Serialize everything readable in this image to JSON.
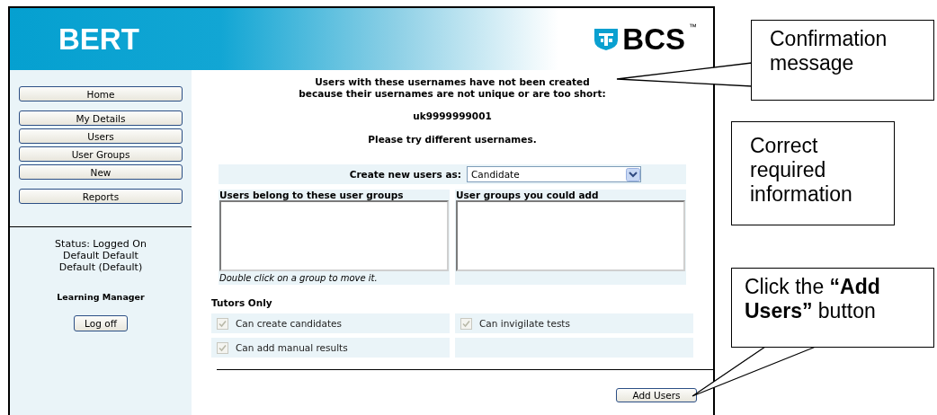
{
  "header": {
    "title": "BERT",
    "logo": {
      "text": "BCS",
      "mark": "™"
    }
  },
  "sidebar": {
    "nav_groups": [
      [
        {
          "label": "Home"
        }
      ],
      [
        {
          "label": "My Details"
        },
        {
          "label": "Users"
        },
        {
          "label": "User Groups"
        },
        {
          "label": "New"
        }
      ],
      [
        {
          "label": "Reports"
        }
      ]
    ],
    "status": [
      "Status: Logged On",
      "Default Default",
      "Default (Default)"
    ],
    "role": "Learning Manager",
    "logoff": "Log off"
  },
  "message": {
    "lines": [
      "Users with these usernames have not been created",
      "because their usernames are not unique or are too short:"
    ],
    "username": "uk9999999001",
    "hint": "Please try different usernames."
  },
  "form": {
    "create_as_label": "Create new users as:",
    "create_as_value": "Candidate",
    "groups": [
      {
        "heading": "Users belong to these user groups",
        "note": "Double click on a group to move it."
      },
      {
        "heading": "User groups you could add"
      }
    ],
    "tutors_heading": "Tutors Only",
    "options": [
      {
        "label": "Can create candidates",
        "checked": true,
        "disabled": true
      },
      {
        "label": "Can invigilate tests",
        "checked": true,
        "disabled": true
      },
      {
        "label": "Can add manual results",
        "checked": true,
        "disabled": true
      }
    ],
    "submit": "Add Users"
  },
  "callouts": [
    {
      "text": "Confirmation message",
      "kind": "left"
    },
    {
      "text": "Correct required information",
      "kind": "plain"
    },
    {
      "text": "Click the **“Add Users”** button",
      "kind": "down"
    }
  ]
}
